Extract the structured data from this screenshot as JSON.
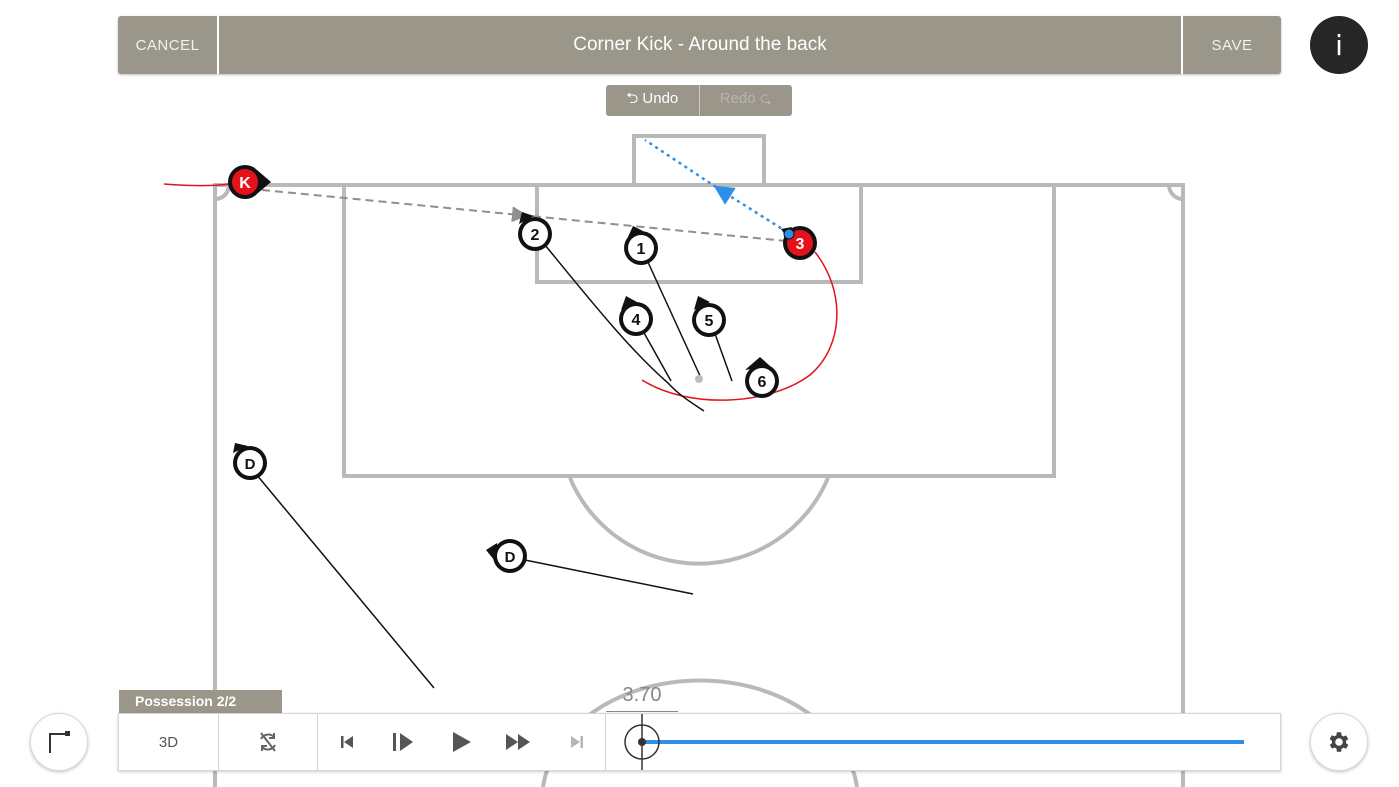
{
  "header": {
    "cancel_label": "CANCEL",
    "title": "Corner Kick - Around the back",
    "save_label": "SAVE",
    "info_label": "i"
  },
  "history": {
    "undo_label": "⮌ Undo",
    "redo_label": "Redo ⮎"
  },
  "players": {
    "kicker": "K",
    "p1": "1",
    "p2": "2",
    "p3": "3",
    "p4": "4",
    "p5": "5",
    "p6": "6",
    "d1": "D",
    "d2": "D"
  },
  "timeline": {
    "possession_label": "Possession 2/2",
    "view_toggle_label": "3D",
    "time_value": "3.70",
    "progress_fraction": 1.0
  },
  "colors": {
    "bar": "#9a968a",
    "pitch_line": "#b9b9b9",
    "attacker_red": "#e3121b",
    "run_line": "#e3121b",
    "pass_blue": "#2f8ee6",
    "progress_blue": "#2f8ee6"
  },
  "icons": {
    "info": "info-icon",
    "corner": "corner-flag-icon",
    "settings": "gear-icon",
    "no_rotate": "rotation-off-icon",
    "skip_start": "skip-to-start-icon",
    "step": "step-forward-icon",
    "play": "play-icon",
    "fast_forward": "fast-forward-icon",
    "skip_end": "skip-to-end-icon"
  }
}
